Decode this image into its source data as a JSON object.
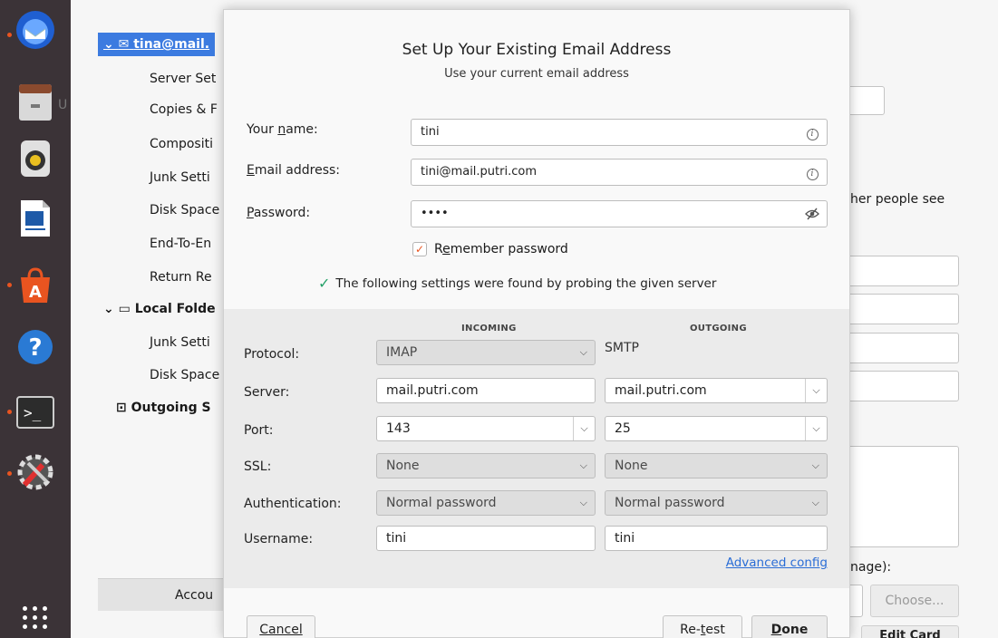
{
  "dialog": {
    "title": "Set Up Your Existing Email Address",
    "subtitle": "Use your current email address",
    "name_label_pre": "Your ",
    "name_label_u": "n",
    "name_label_post": "ame:",
    "name_value": "tini",
    "email_label_u": "E",
    "email_label_post": "mail address:",
    "email_value": "tini@mail.putri.com",
    "password_label_u": "P",
    "password_label_post": "assword:",
    "password_value": "••••",
    "remember_pre": "R",
    "remember_u": "e",
    "remember_post": "member password",
    "found_text": "The following settings were found by probing the given server",
    "incoming_head": "INCOMING",
    "outgoing_head": "OUTGOING",
    "labels": {
      "protocol": "Protocol:",
      "server": "Server:",
      "port": "Port:",
      "ssl": "SSL:",
      "auth": "Authentication:",
      "username": "Username:"
    },
    "incoming": {
      "protocol": "IMAP",
      "server": "mail.putri.com",
      "port": "143",
      "ssl": "None",
      "auth": "Normal password",
      "username": "tini"
    },
    "outgoing": {
      "protocol": "SMTP",
      "server": "mail.putri.com",
      "port": "25",
      "ssl": "None",
      "auth": "Normal password",
      "username": "tini"
    },
    "advanced_config": "Advanced config",
    "cancel": "Cancel",
    "retest_pre": "Re-",
    "retest_u": "t",
    "retest_post": "est",
    "done_u": "D",
    "done_post": "one"
  },
  "background": {
    "tree": {
      "account": "tina@mail.",
      "items": [
        "Server Set",
        "Copies & F",
        "Compositi",
        "Junk Setti",
        "Disk Space",
        "End-To-En",
        "Return Re"
      ],
      "local_folders": "Local Folde",
      "local_items": [
        "Junk Setti",
        "Disk Space"
      ],
      "outgoing": "Outgoing S"
    },
    "accounts_btn": "Accou",
    "other_people": "her people see",
    "image_label": "nage):",
    "choose_btn": "Choose...",
    "edit_card_btn": "Edit Card",
    "partial_u": "U"
  },
  "colors": {
    "accent": "#e95420",
    "selection": "#3c7be0",
    "link": "#2a6dd6",
    "dock": "#3b3337"
  },
  "dock_icons": [
    "thunderbird-icon",
    "file-cabinet-icon",
    "rhythmbox-icon",
    "writer-icon",
    "software-store-icon",
    "help-icon",
    "terminal-icon",
    "settings-tools-icon",
    "app-grid-icon"
  ]
}
